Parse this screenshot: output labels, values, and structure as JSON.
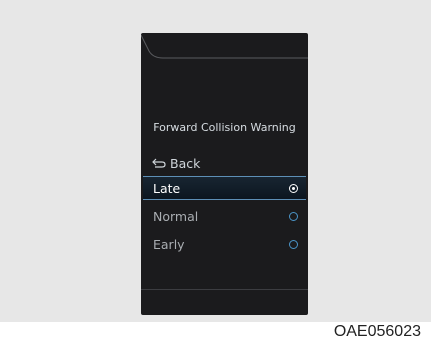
{
  "screen": {
    "title": "Forward Collision Warning",
    "back_label": "Back",
    "options": [
      {
        "label": "Late",
        "selected": true
      },
      {
        "label": "Normal",
        "selected": false
      },
      {
        "label": "Early",
        "selected": false
      }
    ]
  },
  "figure_code": "OAE056023",
  "colors": {
    "screen_bg": "#1b1b1d",
    "highlight_border": "#5d8fb6",
    "radio_accent": "#4b94c7"
  },
  "icons": [
    "back-arrow-icon",
    "radio-selected-icon",
    "radio-unselected-icon"
  ]
}
